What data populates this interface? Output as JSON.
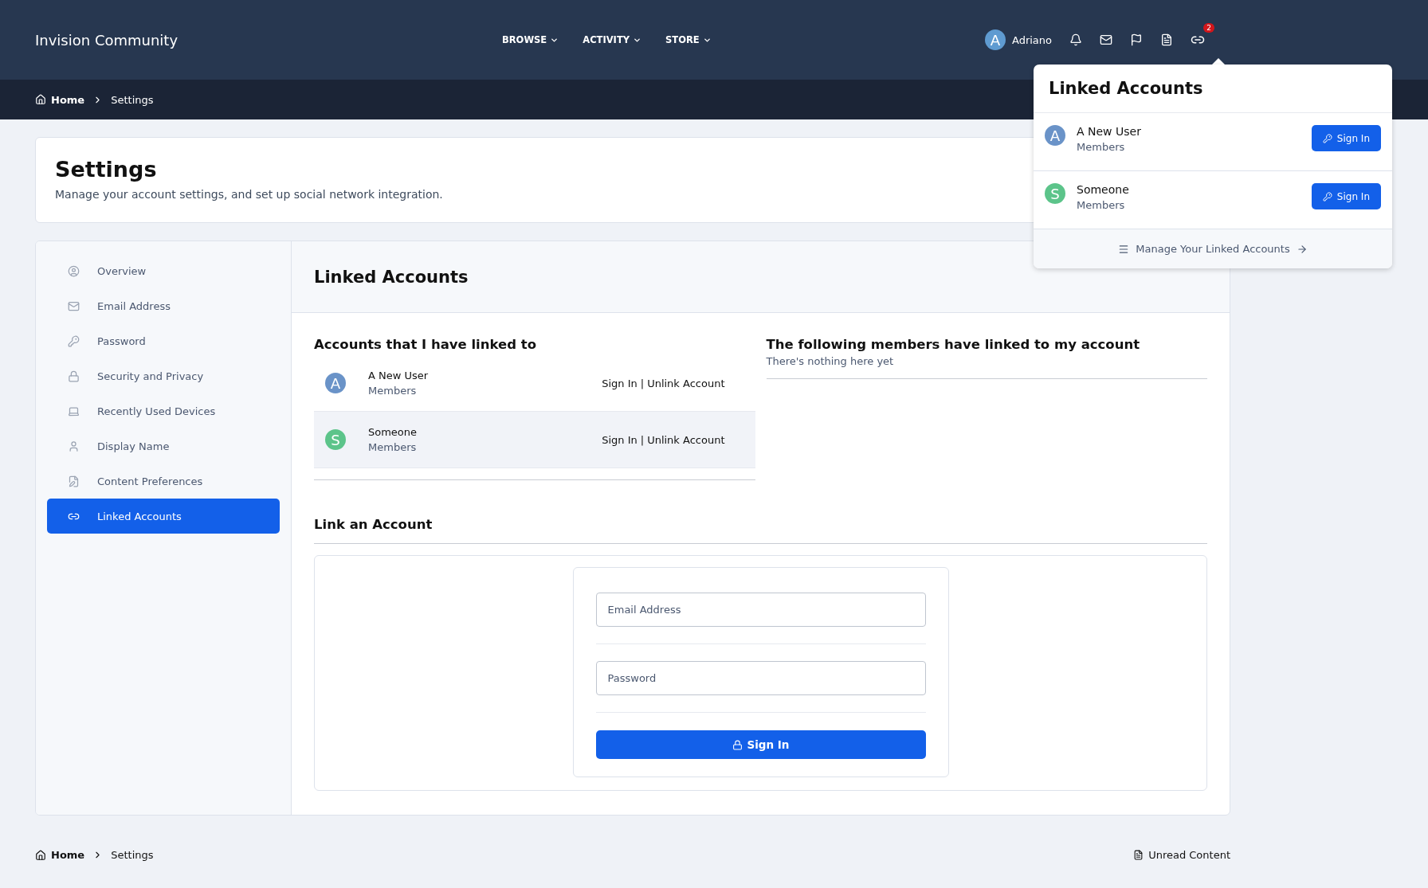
{
  "header": {
    "site_title": "Invision Community",
    "nav": [
      {
        "label": "BROWSE"
      },
      {
        "label": "ACTIVITY"
      },
      {
        "label": "STORE"
      }
    ],
    "user": {
      "initial": "A",
      "name": "Adriano"
    },
    "badge": "2"
  },
  "breadcrumb": [
    {
      "label": "Home"
    },
    {
      "label": "Settings"
    }
  ],
  "page": {
    "title": "Settings",
    "description": "Manage your account settings, and set up social network integration."
  },
  "sidebar": {
    "items": [
      {
        "label": "Overview",
        "selected": false
      },
      {
        "label": "Email Address",
        "selected": false
      },
      {
        "label": "Password",
        "selected": false
      },
      {
        "label": "Security and Privacy",
        "selected": false
      },
      {
        "label": "Recently Used Devices",
        "selected": false
      },
      {
        "label": "Display Name",
        "selected": false
      },
      {
        "label": "Content Preferences",
        "selected": false
      },
      {
        "label": "Linked Accounts",
        "selected": true
      }
    ]
  },
  "section_title": "Linked Accounts",
  "linked_by_me": {
    "heading": "Accounts that I have linked to",
    "accounts": [
      {
        "initial": "A",
        "name": "A New User",
        "group": "Members",
        "color": "#6a93c8",
        "sign_in": "Sign In",
        "separator": "|",
        "unlink": "Unlink Account",
        "hovered": false
      },
      {
        "initial": "S",
        "name": "Someone",
        "group": "Members",
        "color": "#5cc48a",
        "sign_in": "Sign In",
        "separator": "|",
        "unlink": "Unlink Account",
        "hovered": true
      }
    ]
  },
  "linked_to_me": {
    "heading": "The following members have linked to my account",
    "empty_text": "There's nothing here yet"
  },
  "link_account": {
    "heading": "Link an Account",
    "fields": [
      {
        "placeholder": "Email Address"
      },
      {
        "placeholder": "Password"
      }
    ],
    "button": "Sign In"
  },
  "dropdown": {
    "title": "Linked Accounts",
    "accounts": [
      {
        "initial": "A",
        "name": "A New User",
        "group": "Members",
        "color": "#6a93c8",
        "button": "Sign In"
      },
      {
        "initial": "S",
        "name": "Someone",
        "group": "Members",
        "color": "#5cc48a",
        "button": "Sign In"
      }
    ],
    "footer_link": "Manage Your Linked Accounts"
  },
  "footer": {
    "breadcrumb": [
      {
        "label": "Home"
      },
      {
        "label": "Settings"
      }
    ],
    "unread": "Unread Content"
  }
}
